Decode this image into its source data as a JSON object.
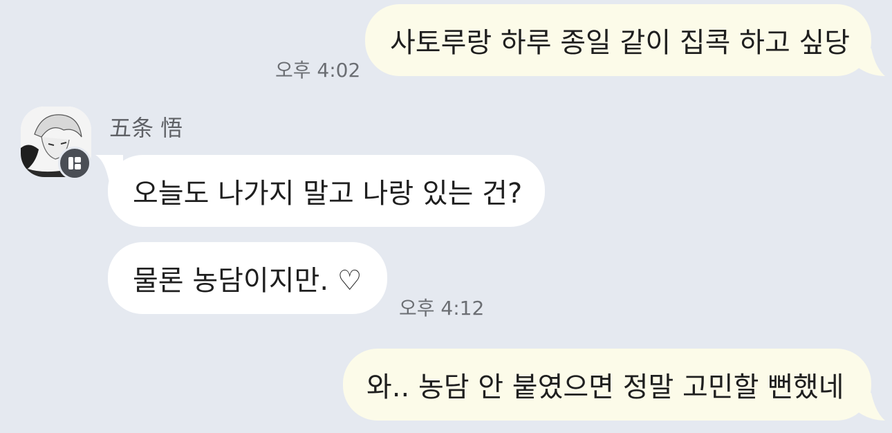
{
  "messages": [
    {
      "id": "m1",
      "direction": "outgoing",
      "text": "사토루랑 하루 종일 같이 집콕 하고 싶당",
      "time": "오후 4:02"
    },
    {
      "id": "m2",
      "direction": "incoming",
      "text": "오늘도 나가지 말고 나랑 있는 건?"
    },
    {
      "id": "m3",
      "direction": "incoming",
      "text": "물론 농담이지만. ♡",
      "time": "오후 4:12"
    },
    {
      "id": "m4",
      "direction": "outgoing",
      "text": "와.. 농담 안 붙였으면 정말 고민할 뻔했네"
    }
  ],
  "contact": {
    "name": "五条 悟",
    "avatar_icon": "profile-avatar-image",
    "badge_icon": "app-badge-icon"
  },
  "colors": {
    "background": "#e5e9f0",
    "outgoing_bubble": "#fcfbe9",
    "incoming_bubble": "#ffffff",
    "time_text": "#6b6e73"
  }
}
